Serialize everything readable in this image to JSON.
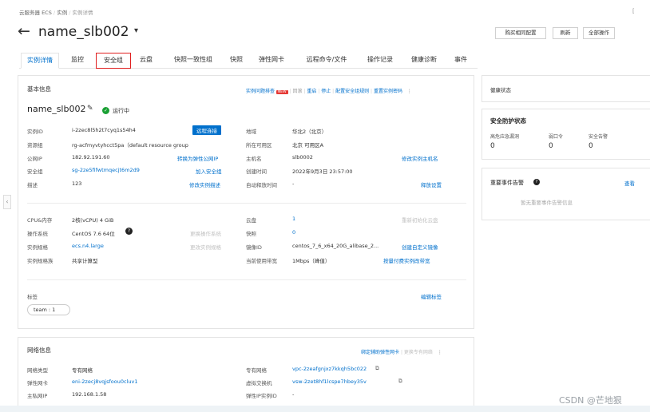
{
  "breadcrumb": {
    "items": [
      "云服务器 ECS",
      "实例",
      "实例详情"
    ]
  },
  "page": {
    "title": "name_slb002"
  },
  "header_buttons": {
    "buy": "购买相同配置",
    "refresh": "刷新",
    "all_ops": "全部操作"
  },
  "tabs": [
    "实例详情",
    "监控",
    "安全组",
    "云盘",
    "快照一致性组",
    "快照",
    "弹性网卡",
    "远程命令/文件",
    "操作记录",
    "健康诊断",
    "事件"
  ],
  "basic": {
    "section_title": "基本信息",
    "actions": [
      "实例问题排查",
      "回滚",
      "重启",
      "停止",
      "配置安全组规则",
      "重置实例密码"
    ],
    "new_badge": "NEW",
    "instance_name": "name_slb002",
    "status": "运行中",
    "left_rows": [
      {
        "label": "实例ID",
        "value": "i-2zec8l5h2t7cyq1s54h4",
        "action": "远程连接"
      },
      {
        "label": "资源组",
        "value": "rg-acfmyvtyhcct5pa（default resource group",
        "action": ""
      },
      {
        "label": "公网IP",
        "value": "182.92.191.60",
        "action": "转换为弹性公网IP"
      },
      {
        "label": "安全组",
        "value": "sg-2ze5fifwtmqecjt6m2d9",
        "action": "加入安全组"
      },
      {
        "label": "描述",
        "value": "123",
        "action": "修改实例描述"
      }
    ],
    "right_rows": [
      {
        "label": "地域",
        "value": "华北2（北京）",
        "action": ""
      },
      {
        "label": "所在可用区",
        "value": "北京 可用区A",
        "action": ""
      },
      {
        "label": "主机名",
        "value": "slb0002",
        "action": "修改实例主机名"
      },
      {
        "label": "创建时间",
        "value": "2022年9月3日 23:57:00",
        "action": ""
      },
      {
        "label": "自动释放时间",
        "value": "-",
        "action": "释放设置"
      }
    ],
    "config_left": [
      {
        "label": "CPU&内存",
        "value": "2核(vCPU) 4 GiB",
        "action": ""
      },
      {
        "label": "操作系统",
        "value": "CentOS 7.6 64位",
        "action": "更换操作系统"
      },
      {
        "label": "实例规格",
        "value": "ecs.n4.large",
        "action": "更改实例规格"
      },
      {
        "label": "实例规格族",
        "value": "共享计算型",
        "action": ""
      }
    ],
    "config_right": [
      {
        "label": "云盘",
        "value": "1",
        "action": "重新初始化云盘"
      },
      {
        "label": "快照",
        "value": "0",
        "action": ""
      },
      {
        "label": "镜像ID",
        "value": "centos_7_6_x64_20G_alibase_2...",
        "action": "创建自定义镜像"
      },
      {
        "label": "当前使用带宽",
        "value": "1Mbps（峰值）",
        "action": "按量付费实例改带宽"
      }
    ],
    "tags_label": "标签",
    "tags_edit": "编辑标签",
    "tag": "team : 1"
  },
  "network": {
    "section_title": "网络信息",
    "actions": [
      "绑定辅助弹性网卡",
      "更换专有网络"
    ],
    "left_rows": [
      {
        "label": "网络类型",
        "value": "专有网络"
      },
      {
        "label": "弹性网卡",
        "value": "eni-2zecj8vqjsfoou0cluv1"
      },
      {
        "label": "主私网IP",
        "value": "192.168.1.58"
      }
    ],
    "right_rows": [
      {
        "label": "专有网络",
        "value": "vpc-2zeafgnjxz7kkqh5bc022"
      },
      {
        "label": "虚拟交换机",
        "value": "vsw-2zet8hf1lcspe7hbey35v"
      },
      {
        "label": "弹性IP实例ID",
        "value": "-"
      }
    ]
  },
  "side": {
    "health": "健康状态",
    "security_title": "安全防护状态",
    "security_cols": [
      {
        "label": "高危应急漏洞",
        "value": "0"
      },
      {
        "label": "弱口令",
        "value": "0"
      },
      {
        "label": "安全告警",
        "value": "0"
      }
    ],
    "events_title": "重要事件告警",
    "events_view": "查看",
    "events_empty": "暂无重要事件告警信息"
  },
  "watermark": "CSDN @芒地狠",
  "colors": {
    "accent": "#0070cc",
    "running": "#1aa034",
    "highlight": "#e02020",
    "danger_badge": "#e53935"
  }
}
